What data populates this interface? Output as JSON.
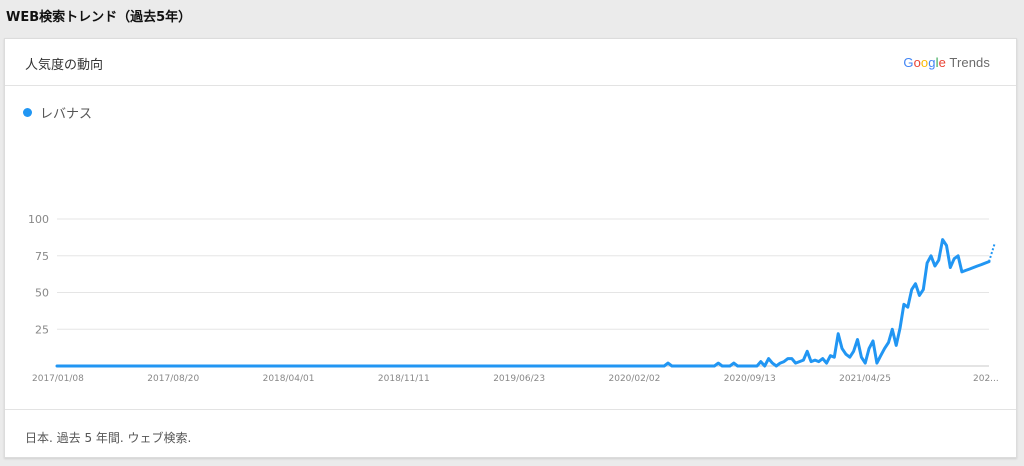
{
  "header": {
    "title": "WEB検索トレンド（過去5年）"
  },
  "card": {
    "title": "人気度の動向",
    "brand": {
      "letters": [
        "G",
        "o",
        "o",
        "g",
        "l",
        "e"
      ],
      "colors": [
        "#4285f4",
        "#ea4335",
        "#fbbc05",
        "#4285f4",
        "#34a853",
        "#ea4335"
      ],
      "suffix": " Trends"
    },
    "footer": "日本. 過去 5 年間. ウェブ検索."
  },
  "chart_data": {
    "type": "line",
    "ylim": [
      0,
      100
    ],
    "yticks": [
      100,
      75,
      50,
      25
    ],
    "grid": true,
    "xtick_labels": [
      "2017/01/08",
      "2017/08/20",
      "2018/04/01",
      "2018/11/11",
      "2019/06/23",
      "2020/02/02",
      "2020/09/13",
      "2021/04/25",
      "202..."
    ],
    "series": [
      {
        "name": "レバナス",
        "color": "#2196f3",
        "x": [
          0,
          157,
          158,
          159,
          160,
          162,
          163,
          164,
          170,
          171,
          172,
          174,
          175,
          176,
          177,
          179,
          180,
          181,
          182,
          183,
          184,
          185,
          186,
          187,
          188,
          189,
          190,
          191,
          192,
          193,
          194,
          195,
          196,
          197,
          198,
          199,
          200,
          201,
          202,
          203,
          204,
          205,
          206,
          207,
          208,
          209,
          210,
          211,
          212,
          213,
          214,
          215,
          216,
          217,
          218,
          219,
          220,
          221,
          222,
          223,
          224,
          225,
          226,
          227,
          228,
          229,
          230,
          231,
          232,
          233,
          234,
          235,
          236,
          237,
          238,
          239,
          240,
          241
        ],
        "values": [
          0,
          0,
          2,
          0,
          0,
          0,
          0,
          0,
          0,
          2,
          0,
          0,
          2,
          0,
          0,
          0,
          0,
          0,
          3,
          0,
          5,
          2,
          0,
          2,
          3,
          5,
          5,
          2,
          3,
          4,
          10,
          3,
          4,
          3,
          5,
          2,
          7,
          6,
          22,
          12,
          8,
          6,
          10,
          18,
          6,
          2,
          12,
          17,
          2,
          7,
          12,
          16,
          25,
          14,
          26,
          42,
          40,
          52,
          56,
          48,
          52,
          70,
          75,
          68,
          72,
          86,
          82,
          67,
          73,
          75,
          64,
          65,
          66,
          67,
          68,
          69,
          70,
          71
        ]
      }
    ]
  }
}
